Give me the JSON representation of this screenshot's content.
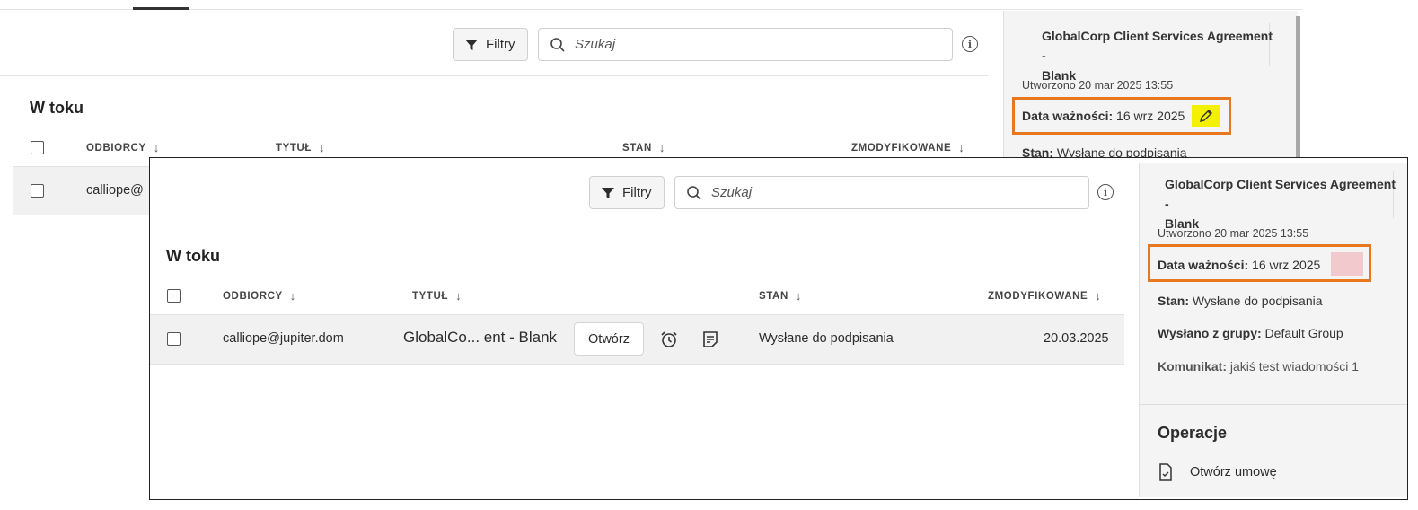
{
  "toolbar": {
    "filter_label": "Filtry",
    "search_placeholder": "Szukaj"
  },
  "section": {
    "title": "W toku"
  },
  "table": {
    "headers": {
      "recipients": "ODBIORCY",
      "title": "TYTUŁ",
      "status": "STAN",
      "modified": "ZMODYFIKOWANE"
    },
    "row": {
      "recipient_truncated": "calliope@",
      "recipient": "calliope@jupiter.dom",
      "title": "GlobalCo... ent - Blank",
      "open_button": "Otwórz",
      "status": "Wysłane do podpisania",
      "modified": "20.03.2025"
    }
  },
  "sidebar": {
    "title_line1": "GlobalCorp Client Services Agreement -",
    "title_line2": "Blank",
    "created": "Utworzono 20 mar 2025 13:55",
    "expiry_label": "Data ważności:",
    "expiry_value": "16 wrz 2025",
    "status_label": "Stan:",
    "status_value": "Wysłane do podpisania",
    "sent_from_label": "Wysłano z grupy:",
    "sent_from_value": "Default Group",
    "message_label": "Komunikat:",
    "message_value": "jakiś test wiadomości 1",
    "operations_title": "Operacje",
    "open_agreement": "Otwórz umowę"
  },
  "colors": {
    "highlight_border": "#e8771e",
    "edit_highlight": "#f3f000",
    "edit_removed": "#f2c9cc"
  },
  "icons": [
    "filter-icon",
    "search-icon",
    "info-icon",
    "pencil-icon",
    "alarm-clock-icon",
    "notes-icon",
    "document-icon"
  ]
}
